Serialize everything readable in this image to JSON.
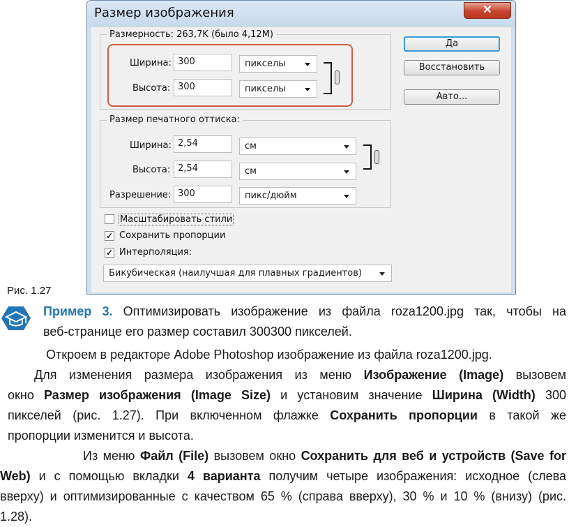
{
  "dialog": {
    "title": "Размер изображения",
    "close_label": "✕",
    "dimensions_label": "Размерность:  263,7K (было 4,12M)",
    "pixel": {
      "width_label": "Ширина:",
      "width_value": "300",
      "width_unit": "пикселы",
      "height_label": "Высота:",
      "height_value": "300",
      "height_unit": "пикселы"
    },
    "print_group_label": "Размер печатного оттиска:",
    "print": {
      "width_label": "Ширина:",
      "width_value": "2,54",
      "width_unit": "см",
      "height_label": "Высота:",
      "height_value": "2,54",
      "height_unit": "см",
      "resolution_label": "Разрешение:",
      "resolution_value": "300",
      "resolution_unit": "пикс/дюйм"
    },
    "checkboxes": {
      "scale_styles": "Масштабировать стили",
      "constrain": "Сохранить пропорции",
      "resample": "Интерполяция:",
      "check_mark": "✓"
    },
    "resample_method": "Бикубическая (наилучшая для плавных градиентов)",
    "buttons": {
      "ok": "Да",
      "reset": "Восстановить",
      "auto": "Авто..."
    }
  },
  "caption": "Рис. 1.27",
  "example": {
    "label": "Пример 3.",
    "text1": " Оптимизировать изображение из файла roza1200.jpg так, чтобы на",
    "text2": "веб-странице его размер составил 300300 пикселей."
  },
  "body": {
    "p1": "Откроем в редакторе Adobe Photoshop изображение из файла roza1200.jpg.",
    "p2_a": "Для изменения размера изображения из меню ",
    "p2_b": "Изображение (Image)",
    "p2_c": " вызовем",
    "p2_d": "окно ",
    "p2_e": "Размер изображения (Image Size)",
    "p2_f": " и установим значение ",
    "p2_g": "Ширина (Width)",
    "p2_h": " 300",
    "p2_i": "пикселей (рис. 1.27). При включенном флажке ",
    "p2_j": "Сохранить пропорции",
    "p2_k": " в такой же",
    "p2_l": "пропорции изменится и высота.",
    "p3_a": "Из меню ",
    "p3_b": "Файл (File)",
    "p3_c": " вызовем окно ",
    "p3_d": "Сохранить для веб и устройств (Save for",
    "p3_e": "Web)",
    "p3_f": " и с помощью вкладки ",
    "p3_g": "4 варианта",
    "p3_h": " получим четыре изображения: исходное (слева",
    "p3_i": "вверху) и оптимизированные с качеством 65 % (справа вверху), 30 % и 10 % (внизу) (рис.",
    "p3_j": "1.28)."
  }
}
